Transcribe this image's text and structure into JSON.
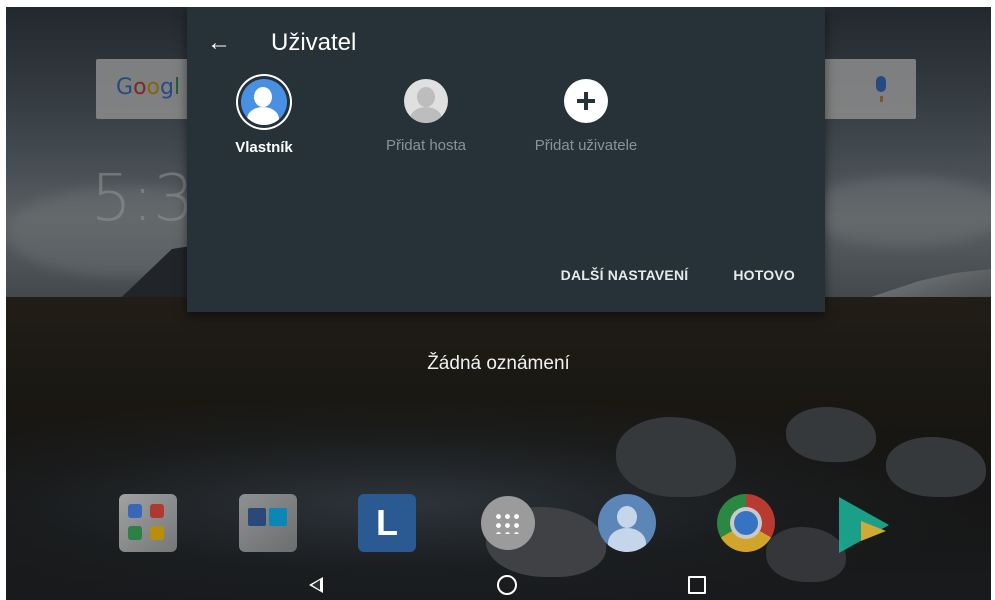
{
  "panel": {
    "title": "Uživatel",
    "users": [
      {
        "label": "Vlastník",
        "icon": "user-avatar-icon"
      },
      {
        "label": "Přidat hosta",
        "icon": "guest-avatar-icon"
      },
      {
        "label": "Přidat uživatele",
        "icon": "add-user-icon"
      }
    ],
    "actions": {
      "more_settings": "DALŠÍ NASTAVENÍ",
      "done": "HOTOVO"
    }
  },
  "home": {
    "search_logo": "Google",
    "clock": "5:3",
    "notifications": "Žádná oznámení"
  },
  "dock": {
    "apps": [
      "google-apps-folder",
      "office-apps-folder",
      "lenovo-app",
      "app-drawer",
      "user-app",
      "chrome-app",
      "play-store-app"
    ],
    "lenovo_letter": "L"
  },
  "colors": {
    "panel_bg": "#263238",
    "owner_accent": "#4a90e2"
  }
}
